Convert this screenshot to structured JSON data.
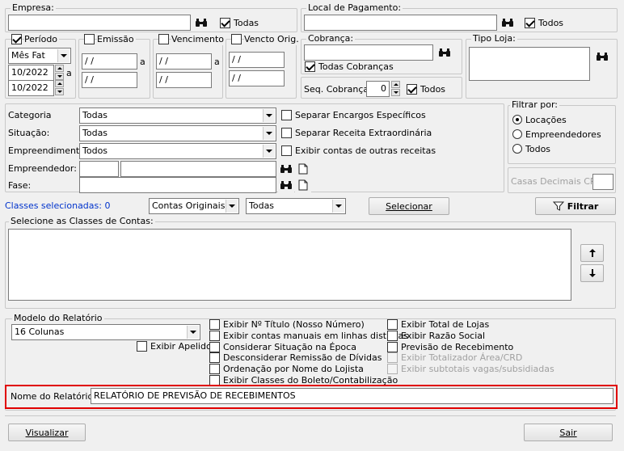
{
  "empresa": {
    "label": "Empresa:",
    "todas_label": "Todas",
    "todas_checked": true
  },
  "local_pagamento": {
    "label": "Local de Pagamento:",
    "todos_label": "Todos",
    "todos_checked": true
  },
  "periodo": {
    "label": "Período",
    "checked": true,
    "tipo": "Mês Fat",
    "inicio": "10/2022",
    "fim": "10/2022",
    "a": "a"
  },
  "emissao": {
    "label": "Emissão",
    "de": " / /",
    "ate": " / /",
    "a": "a"
  },
  "vencimento": {
    "label": "Vencimento",
    "de": " / /",
    "ate": " / /",
    "a": "a"
  },
  "vencto_orig": {
    "label": "Vencto Orig.",
    "de": " / /",
    "ate": " / /"
  },
  "cobranca": {
    "label": "Cobrança:",
    "todas_label": "Todas Cobranças",
    "todas_checked": true,
    "seq_label": "Seq. Cobrança:",
    "seq_value": "0",
    "todos_label": "Todos",
    "todos_checked": true
  },
  "tipo_loja": {
    "label": "Tipo Loja:"
  },
  "filtros": {
    "categoria_label": "Categoria",
    "categoria_value": "Todas",
    "situacao_label": "Situação:",
    "situacao_value": "Todas",
    "empreendimento_label": "Empreendimento:",
    "empreendimento_value": "Todos",
    "empreendedor_label": "Empreendedor:",
    "fase_label": "Fase:",
    "separar_encargos": "Separar Encargos Específicos",
    "separar_receita": "Separar Receita Extraordinária",
    "exibir_contas": "Exibir contas de outras receitas"
  },
  "filtrar_por": {
    "label": "Filtrar por:",
    "options": [
      "Locações",
      "Empreendedores",
      "Todos"
    ],
    "selected": 0
  },
  "casas_decimais": {
    "label": "Casas Decimais CRD"
  },
  "classes": {
    "selecionadas": "Classes selecionadas: 0",
    "contas_value": "Contas Originais",
    "todas_value": "Todas",
    "selecionar": "Selecionar",
    "filtrar": "Filtrar",
    "list_label": "Selecione as Classes de Contas:"
  },
  "modelo": {
    "label": "Modelo do Relatório",
    "value": "16 Colunas",
    "exibir_apelido": "Exibir Apelido"
  },
  "opcoes_col1": [
    "Exibir Nº Título (Nosso Número)",
    "Exibir contas manuais em linhas distintas",
    "Considerar Situação na Época",
    "Desconsiderar Remissão de Dívidas",
    "Ordenação por Nome do Lojista",
    "Exibir Classes do Boleto/Contabilização"
  ],
  "opcoes_col2": [
    "Exibir Total de Lojas",
    "Exibir Razão Social",
    "Previsão de Recebimento",
    "Exibir Totalizador Área/CRD",
    "Exibir subtotais vagas/subsidiadas"
  ],
  "nome_relatorio": {
    "label": "Nome do Relatório:",
    "value": "RELATÓRIO DE PREVISÃO DE RECEBIMENTOS"
  },
  "buttons": {
    "visualizar": "Visualizar",
    "sair": "Sair"
  },
  "colors": {
    "highlight": "#e00000",
    "link_blue": "#0033cc"
  }
}
